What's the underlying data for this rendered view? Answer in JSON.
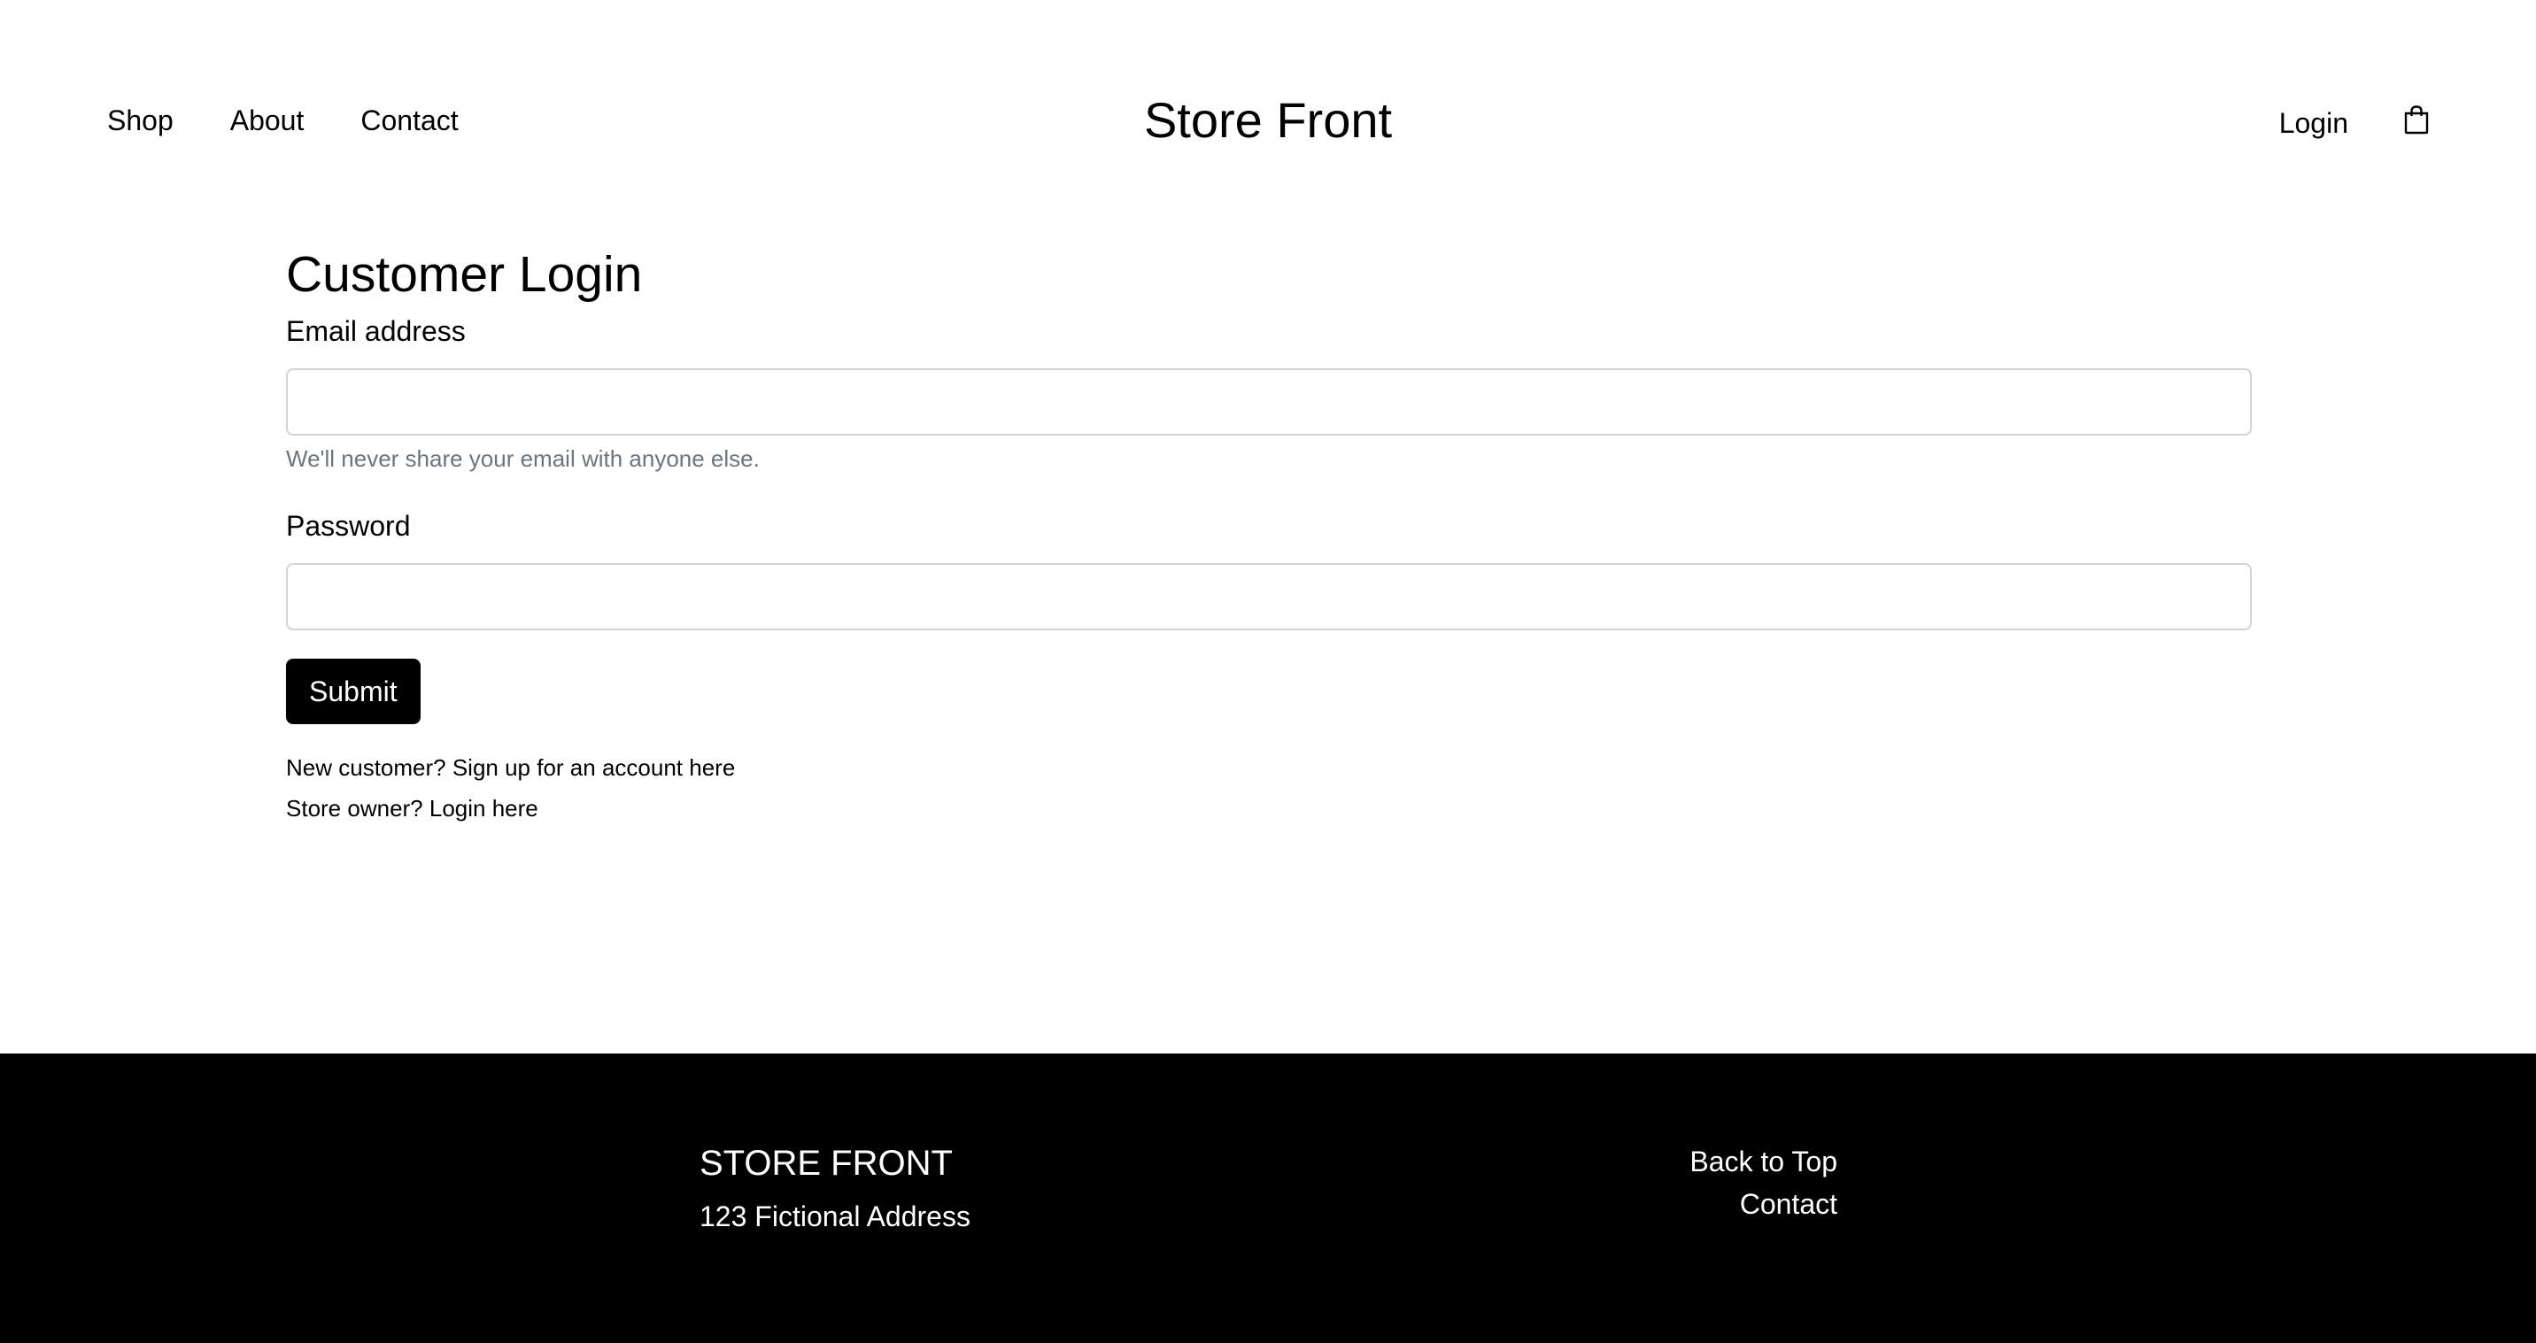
{
  "nav": {
    "links": [
      "Shop",
      "About",
      "Contact"
    ],
    "brand": "Store Front",
    "login": "Login",
    "cart_icon": "shopping-bag-icon"
  },
  "login_form": {
    "title": "Customer Login",
    "email_label": "Email address",
    "email_value": "",
    "email_help": "We'll never share your email with anyone else.",
    "password_label": "Password",
    "password_value": "",
    "submit_label": "Submit",
    "signup_link": "New customer? Sign up for an account here",
    "owner_link": "Store owner? Login here"
  },
  "footer": {
    "brand": "STORE FRONT",
    "address": "123 Fictional Address",
    "back_to_top": "Back to Top",
    "contact": "Contact"
  },
  "colors": {
    "button_bg": "#000000",
    "footer_bg": "#000000",
    "help_text": "#6c757d",
    "input_border": "#d0d4d8"
  }
}
